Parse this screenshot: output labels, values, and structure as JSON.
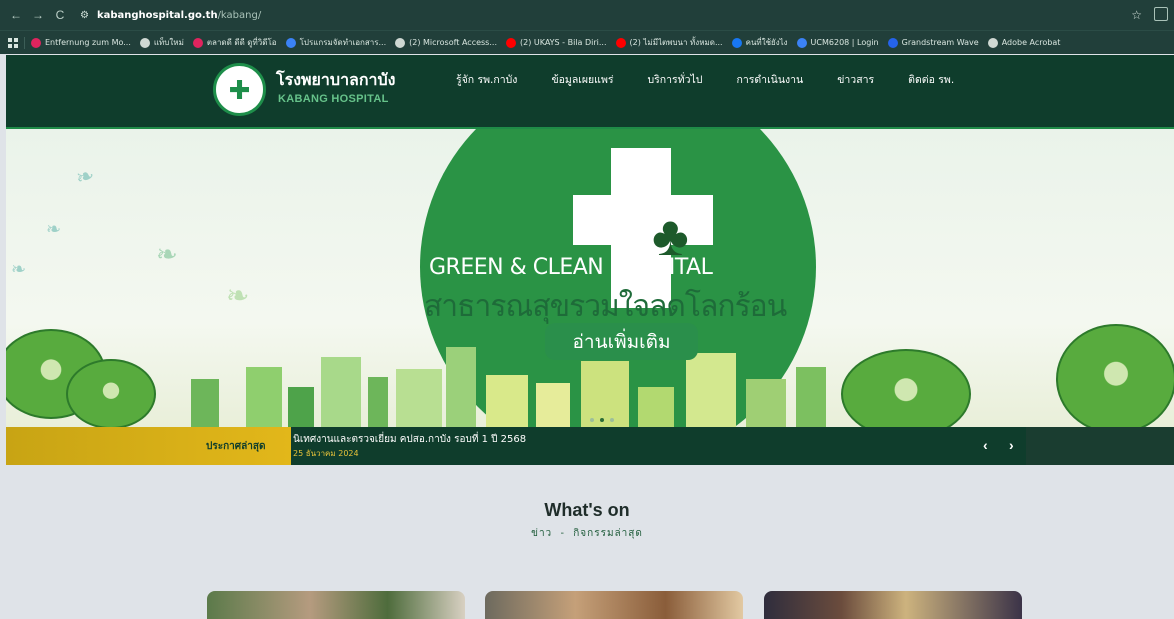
{
  "browser": {
    "url_host": "kabanghospital.go.th",
    "url_path": "/kabang/",
    "bookmarks": [
      {
        "label": "Entfernung zum Mo...",
        "color": "#e0245e"
      },
      {
        "label": "แท็บใหม่",
        "color": "#cfd8d3"
      },
      {
        "label": "ตลาดดี ดีดี ดูที่วิดีโอ",
        "color": "#e0245e"
      },
      {
        "label": "โปรแกรมจัดทำเอกสาร...",
        "color": "#3b82f6"
      },
      {
        "label": "(2) Microsoft Access...",
        "color": "#cfd8d3"
      },
      {
        "label": "(2) UKAYS - Bila Diri...",
        "color": "#ff0000"
      },
      {
        "label": "(2) ไม่มีไตพบนา ทั้งหมด...",
        "color": "#ff0000"
      },
      {
        "label": "คนที่ใช้ยังไง",
        "color": "#1877f2"
      },
      {
        "label": "UCM6208 | Login",
        "color": "#3b82f6"
      },
      {
        "label": "Grandstream Wave",
        "color": "#2563eb"
      },
      {
        "label": "Adobe Acrobat",
        "color": "#cfd8d3"
      }
    ]
  },
  "header": {
    "logo_th": "โรงพยาบาลกาบัง",
    "logo_en": "KABANG HOSPITAL",
    "menu": [
      "รู้จัก รพ.กาบัง",
      "ข้อมูลเผยแพร่",
      "บริการทั่วไป",
      "การดำเนินงาน",
      "ข่าวสาร",
      "ติดต่อ รพ."
    ]
  },
  "hero": {
    "headline": "GREEN & CLEAN  HOSPITAL",
    "slogan": "สาธารณสุขรวมใจลดโลกร้อน",
    "button": "อ่านเพิ่มเติม"
  },
  "ticker": {
    "label": "ประกาศล่าสุด",
    "title": "นิเทศงานและตรวจเยี่ยม คปสอ.กาบัง รอบที่ 1 ปี 2568",
    "date": "25 ธันวาคม 2024",
    "prev": "‹",
    "next": "›"
  },
  "section": {
    "title": "What's on",
    "subtitle": "ข่าว - กิจกรรมล่าสุด"
  },
  "colors": {
    "header_bg": "#0f3d2c",
    "accent_green": "#2a8f4b",
    "ticker_yellow": "#e2b71a"
  }
}
